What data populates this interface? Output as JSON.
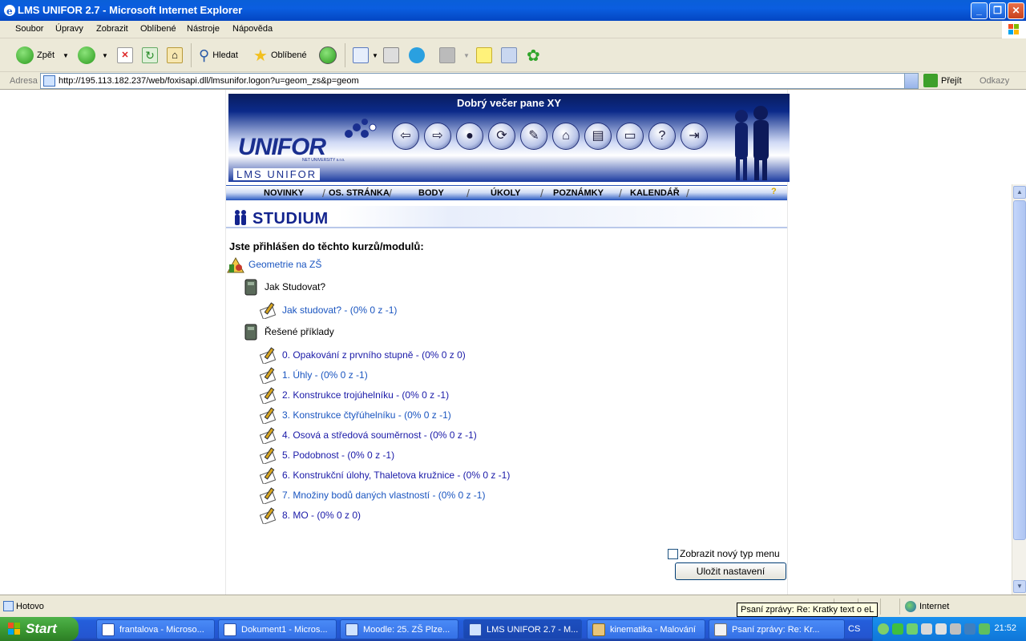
{
  "window": {
    "title": "LMS UNIFOR 2.7 - Microsoft Internet Explorer"
  },
  "menu": [
    "Soubor",
    "Úpravy",
    "Zobrazit",
    "Oblíbené",
    "Nástroje",
    "Nápověda"
  ],
  "toolbar": {
    "back": "Zpět",
    "search": "Hledat",
    "favorites": "Oblíbené"
  },
  "address": {
    "label": "Adresa",
    "url": "http://195.113.182.237/web/foxisapi.dll/lmsunifor.logon?u=geom_zs&p=geom",
    "go": "Přejít",
    "links": "Odkazy"
  },
  "banner": {
    "greeting": "Dobrý večer pane XY",
    "logo": "UNIFOR",
    "logo_sub": "NET UNIVERSITY s.r.o.",
    "product": "LMS UNIFOR"
  },
  "nav": [
    "NOVINKY",
    "OS. STRÁNKA",
    "BODY",
    "ÚKOLY",
    "POZNÁMKY",
    "KALENDÁŘ"
  ],
  "section_title": "STUDIUM",
  "intro": "Jste přihlášen do těchto kurzů/modulů:",
  "course": "Geometrie na ZŠ",
  "groups": [
    {
      "title": "Jak Studovat?",
      "items": [
        "Jak studovat? - (0% 0 z -1)"
      ]
    },
    {
      "title": "Řešené příklady",
      "items": [
        "0. Opakování z prvního stupně - (0% 0 z 0)",
        "1. Úhly - (0% 0 z -1)",
        "2. Konstrukce trojúhelníku - (0% 0 z -1)",
        "3. Konstrukce čtyřúhelníku - (0% 0 z -1)",
        "4. Osová a středová souměrnost - (0% 0 z -1)",
        "5. Podobnost - (0% 0 z -1)",
        "6. Konstrukční úlohy, Thaletova kružnice - (0% 0 z -1)",
        "7. Množiny bodů daných vlastností - (0% 0 z -1)",
        "8. MO - (0% 0 z 0)"
      ]
    }
  ],
  "options": {
    "checkbox_label": "Zobrazit nový typ menu",
    "save_button": "Uložit nastavení"
  },
  "status": {
    "text": "Hotovo",
    "zone": "Internet",
    "tooltip": "Psaní zprávy: Re: Kratky text o eL"
  },
  "taskbar": {
    "start": "Start",
    "tasks": [
      "frantalova - Microso...",
      "Dokument1 - Micros...",
      "Moodle: 25. ZŠ Plze...",
      "LMS UNIFOR 2.7 - M...",
      "kinematika - Malování",
      "Psaní zprávy: Re: Kr..."
    ],
    "language": "CS",
    "clock": "21:52"
  }
}
